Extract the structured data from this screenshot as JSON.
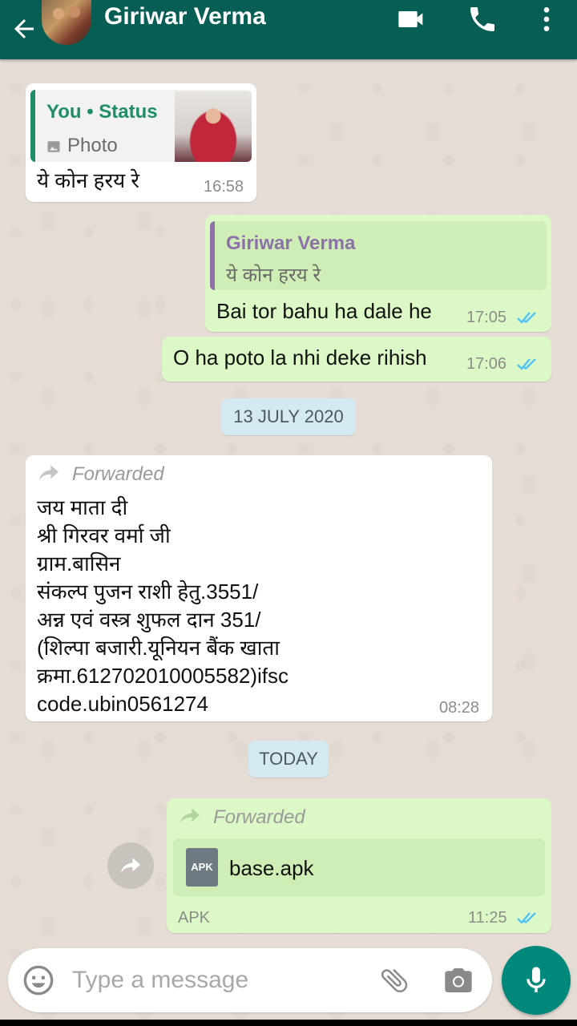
{
  "header": {
    "contact_name": "Giriwar Verma",
    "icons": [
      "back-arrow-icon",
      "avatar",
      "video-call-icon",
      "voice-call-icon",
      "more-options-icon"
    ]
  },
  "colors": {
    "header": "#075e54",
    "incoming_bubble": "#ffffff",
    "outgoing_bubble": "#dcf8c6",
    "status_quote_accent": "#1e8f63",
    "reply_quote_accent": "#8c70a8",
    "read_ticks": "#4fc3f7",
    "mic_button": "#00897b",
    "date_chip": "#d5e9f3"
  },
  "messages": {
    "m1": {
      "quote_title": "You • Status",
      "quote_sub": "Photo",
      "text": "ये कोन हरय रे",
      "time": "16:58"
    },
    "m2": {
      "quote_title": "Giriwar Verma",
      "quote_sub": "ये कोन हरय रे",
      "text": "Bai tor bahu ha dale he",
      "time": "17:05"
    },
    "m3": {
      "text": "O ha poto la nhi deke rihish",
      "time": "17:06"
    },
    "date1": "13 JULY 2020",
    "m4": {
      "forwarded": "Forwarded",
      "text": "जय माता दी\nश्री गिरवर वर्मा जी\nग्राम.बासिन\nसंकल्प पुजन राशी हेतु.3551/\nअन्न एवं वस्त्र शुफल  दान 351/\n(शिल्पा बजारी.यूनियन बैंक खाता\nक्रमा.612702010005582)ifsc\ncode.ubin0561274",
      "time": "08:28"
    },
    "date2": "TODAY",
    "m5": {
      "forwarded": "Forwarded",
      "file_badge": "APK",
      "file_name": "base.apk",
      "file_type": "APK",
      "time": "11:25"
    }
  },
  "composer": {
    "placeholder": "Type a message"
  }
}
